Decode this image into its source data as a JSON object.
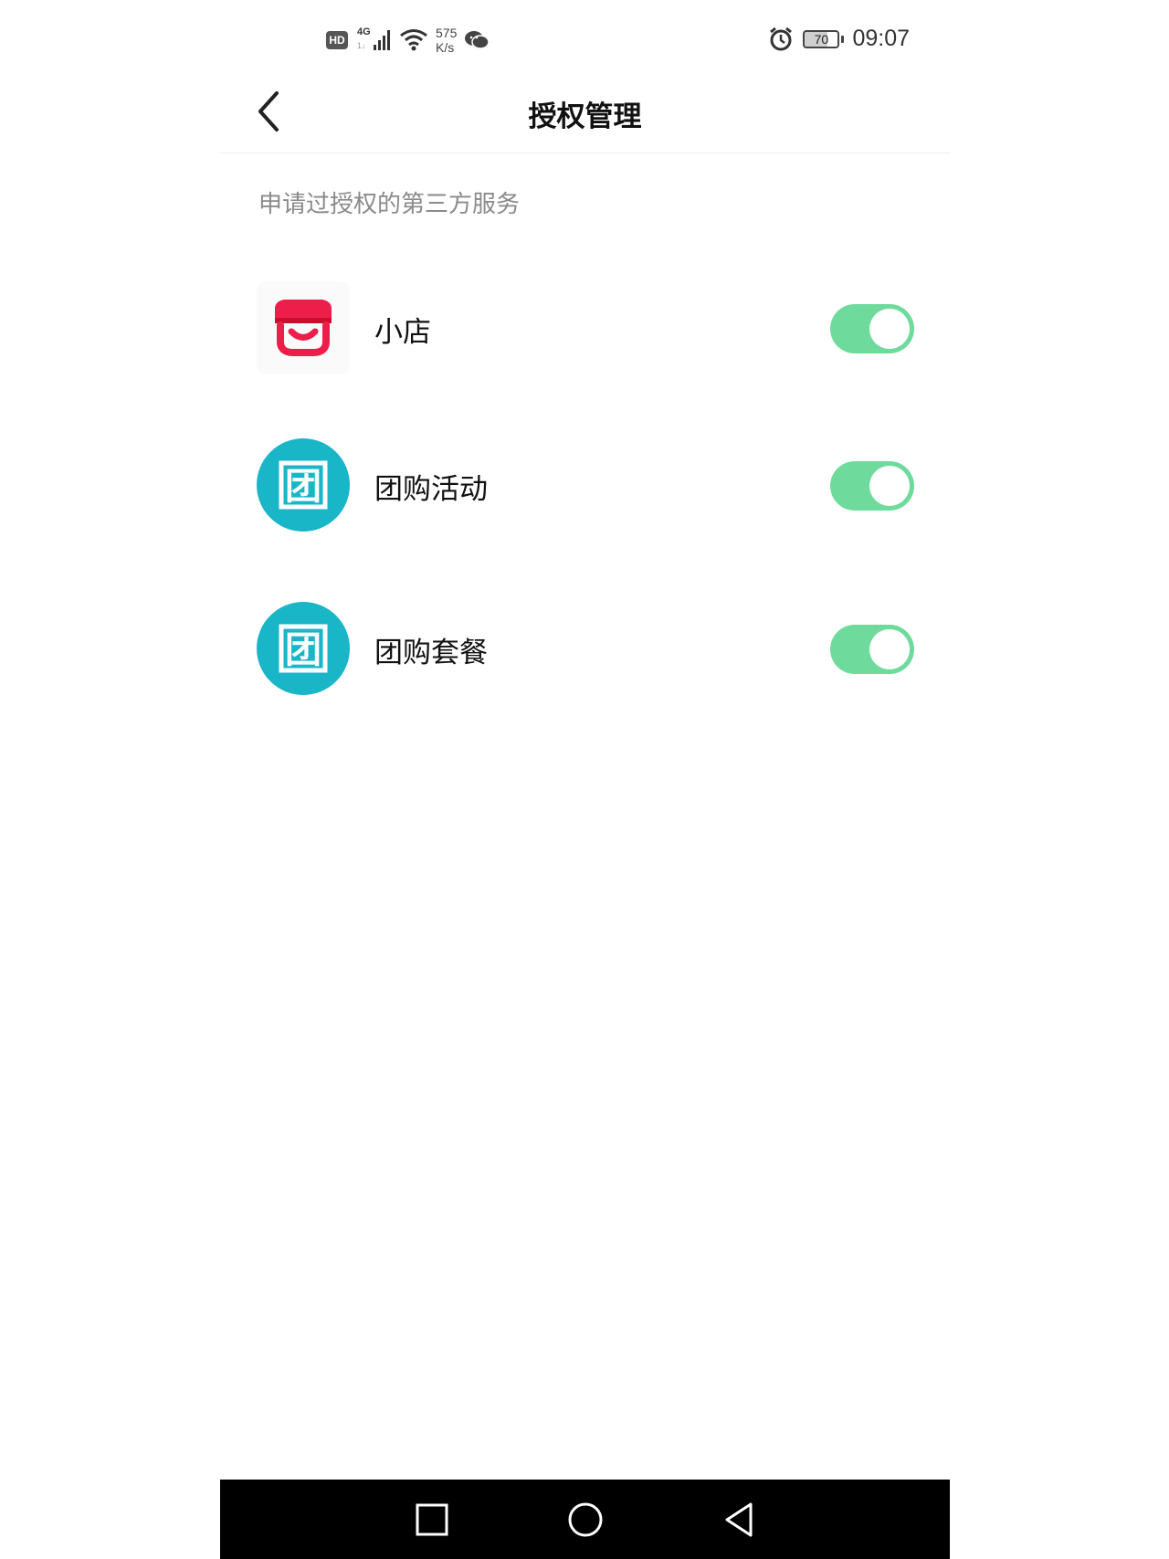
{
  "status_bar": {
    "hd_badge": "HD",
    "network_type": "4G",
    "network_sub": "1↓",
    "speed_value": "575",
    "speed_unit": "K/s",
    "battery": "70",
    "time": "09:07",
    "icons": [
      "hd-icon",
      "signal-icon",
      "wifi-icon",
      "wechat-icon",
      "alarm-icon",
      "battery-icon"
    ]
  },
  "header": {
    "title": "授权管理",
    "back_icon": "chevron-left-icon"
  },
  "section": {
    "label": "申请过授权的第三方服务"
  },
  "services": [
    {
      "name": "小店",
      "icon": "shop-icon",
      "enabled": true
    },
    {
      "name": "团购活动",
      "icon": "tuan-icon",
      "icon_glyph": "团",
      "enabled": true
    },
    {
      "name": "团购套餐",
      "icon": "tuan-icon",
      "icon_glyph": "团",
      "enabled": true
    }
  ],
  "colors": {
    "toggle_on": "#6edb9d",
    "tuan_icon_bg": "#19b6c8",
    "shop_icon_red": "#ee1e4b",
    "nav_bar_bg": "#000000"
  },
  "nav_bar": {
    "buttons": [
      "recent-apps-icon",
      "home-icon",
      "back-triangle-icon"
    ]
  }
}
